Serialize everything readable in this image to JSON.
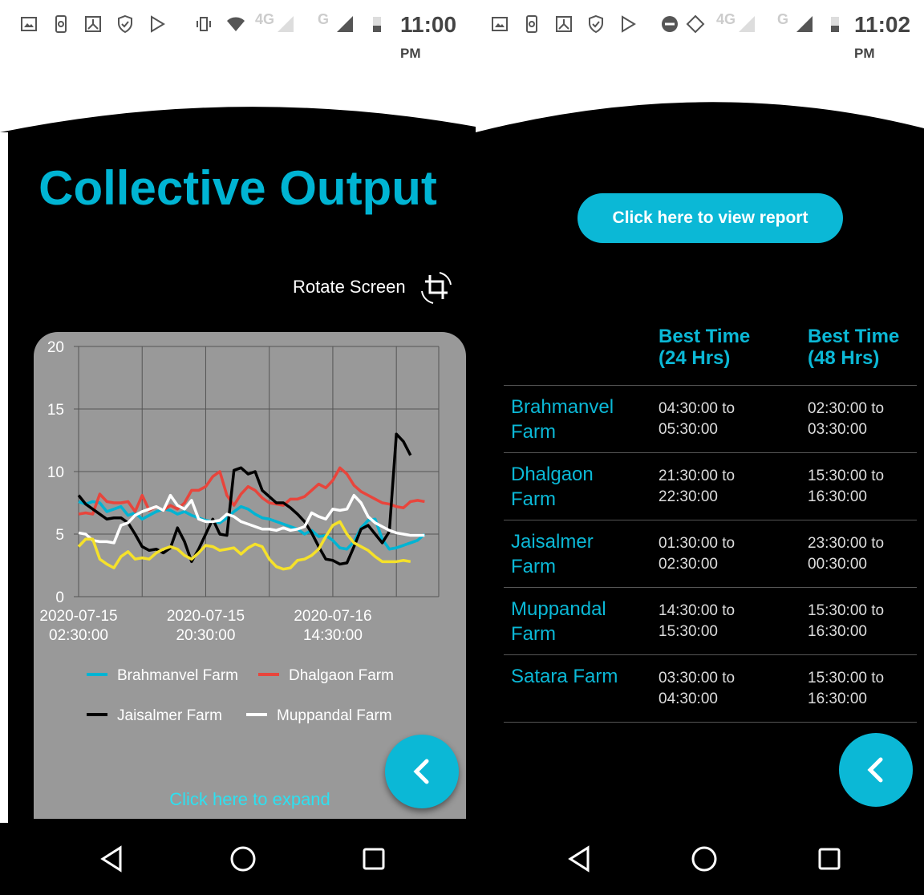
{
  "left_screen": {
    "status": {
      "time": "11:00",
      "ampm": "PM",
      "net1": "4G",
      "net2": "G"
    },
    "title": "Collective Output",
    "rotate_label": "Rotate Screen",
    "expand_label": "Click here to expand"
  },
  "right_screen": {
    "status": {
      "time": "11:02",
      "ampm": "PM",
      "net1": "4G",
      "net2": "G"
    },
    "report_button": "Click here to view report",
    "headers": [
      "Best Time (24 Hrs)",
      "Best Time (48 Hrs)"
    ],
    "rows": [
      {
        "farm": "Brahmanvel Farm",
        "t24": [
          "04:30:00 to",
          "05:30:00"
        ],
        "t48": [
          "02:30:00 to",
          "03:30:00"
        ]
      },
      {
        "farm": "Dhalgaon Farm",
        "t24": [
          "21:30:00 to",
          "22:30:00"
        ],
        "t48": [
          "15:30:00 to",
          "16:30:00"
        ]
      },
      {
        "farm": "Jaisalmer Farm",
        "t24": [
          "01:30:00 to",
          "02:30:00"
        ],
        "t48": [
          "23:30:00 to",
          "00:30:00"
        ]
      },
      {
        "farm": "Muppandal Farm",
        "t24": [
          "14:30:00 to",
          "15:30:00"
        ],
        "t48": [
          "15:30:00 to",
          "16:30:00"
        ]
      },
      {
        "farm": "Satara Farm",
        "t24": [
          "03:30:00 to",
          "04:30:00"
        ],
        "t48": [
          "15:30:00 to",
          "16:30:00"
        ]
      }
    ]
  },
  "colors": {
    "accent": "#0bb8d6",
    "Brahmanvel Farm": "#00b4d3",
    "Dhalgaon Farm": "#e8453c",
    "Jaisalmer Farm": "#000000",
    "Muppandal Farm": "#ffffff",
    "yellow_series": "#f5e12a"
  },
  "chart_data": {
    "type": "line",
    "ylim": [
      0,
      20
    ],
    "yticks": [
      0,
      5,
      10,
      15,
      20
    ],
    "xticks": [
      {
        "label": [
          "2020-07-15",
          "02:30:00"
        ],
        "index": 0
      },
      {
        "label": [
          "2020-07-15",
          "20:30:00"
        ],
        "index": 18
      },
      {
        "label": [
          "2020-07-16",
          "14:30:00"
        ],
        "index": 36
      }
    ],
    "grid": true,
    "legend": "bottom",
    "series": [
      {
        "name": "Brahmanvel Farm",
        "color": "#00b4d3",
        "values": [
          7.6,
          7.4,
          7.6,
          7.5,
          6.8,
          7.0,
          7.2,
          6.5,
          6.7,
          6.2,
          6.5,
          6.8,
          7.0,
          6.9,
          6.6,
          6.8,
          6.5,
          6.3,
          6.1,
          6.0,
          5.9,
          6.3,
          6.8,
          7.2,
          7.0,
          6.6,
          6.3,
          6.2,
          6.0,
          5.8,
          5.6,
          5.4,
          5.0,
          5.3,
          4.8,
          4.9,
          4.5,
          3.9,
          3.8,
          4.4,
          5.5,
          6.1,
          6.2,
          4.6,
          3.8,
          3.9,
          4.1,
          4.3,
          4.5,
          5.0
        ]
      },
      {
        "name": "Dhalgaon Farm",
        "color": "#e8453c",
        "values": [
          6.6,
          6.7,
          6.6,
          8.2,
          7.6,
          7.5,
          7.5,
          7.6,
          6.8,
          8.1,
          6.9,
          7.2,
          6.9,
          7.3,
          7.0,
          7.5,
          8.5,
          8.5,
          8.8,
          9.6,
          10.0,
          8.1,
          7.3,
          8.2,
          8.8,
          8.5,
          7.9,
          7.5,
          7.4,
          7.3,
          7.8,
          7.8,
          8.0,
          8.5,
          9.0,
          8.7,
          9.3,
          10.3,
          9.8,
          8.9,
          8.4,
          8.1,
          7.8,
          7.5,
          7.4,
          7.2,
          7.1,
          7.6,
          7.7,
          7.6
        ]
      },
      {
        "name": "Jaisalmer Farm",
        "color": "#000000",
        "values": [
          8.1,
          7.4,
          7.0,
          6.6,
          6.2,
          6.3,
          6.3,
          5.9,
          5.0,
          4.0,
          3.7,
          3.8,
          3.5,
          3.9,
          5.5,
          4.4,
          2.8,
          3.8,
          5.0,
          6.2,
          5.0,
          4.9,
          10.1,
          10.3,
          9.8,
          10.0,
          8.5,
          8.0,
          7.5,
          7.5,
          7.1,
          6.6,
          6.0,
          5.1,
          4.0,
          3.0,
          2.9,
          2.6,
          2.7,
          4.0,
          5.4,
          5.7,
          5.0,
          4.3,
          5.2,
          13.0,
          12.4,
          11.3
        ]
      },
      {
        "name": "Muppandal Farm",
        "color": "#ffffff",
        "values": [
          5.1,
          5.0,
          4.5,
          4.4,
          4.4,
          4.3,
          5.7,
          5.9,
          6.5,
          6.8,
          7.0,
          7.2,
          6.9,
          8.1,
          7.3,
          7.0,
          7.7,
          6.2,
          6.0,
          6.0,
          6.1,
          6.6,
          6.4,
          6.0,
          5.8,
          5.6,
          5.4,
          5.4,
          5.3,
          5.5,
          5.3,
          5.4,
          5.6,
          6.7,
          6.4,
          6.2,
          7.0,
          6.9,
          7.0,
          8.1,
          7.5,
          6.4,
          5.9,
          5.6,
          5.3,
          5.1,
          5.0,
          4.9,
          4.9,
          4.9
        ]
      },
      {
        "color": "#f5e12a",
        "values": [
          4.0,
          4.6,
          4.6,
          3.0,
          2.6,
          2.3,
          3.2,
          3.6,
          3.0,
          3.1,
          3.0,
          3.5,
          3.8,
          4.0,
          3.8,
          3.3,
          3.0,
          3.5,
          4.1,
          4.0,
          3.7,
          3.8,
          3.9,
          3.4,
          3.9,
          4.2,
          4.0,
          3.0,
          2.4,
          2.2,
          2.3,
          2.9,
          3.0,
          3.3,
          3.8,
          4.8,
          5.7,
          6.0,
          5.0,
          4.3,
          4.0,
          3.7,
          3.2,
          2.8,
          2.8,
          2.8,
          2.9,
          2.8
        ]
      }
    ]
  }
}
